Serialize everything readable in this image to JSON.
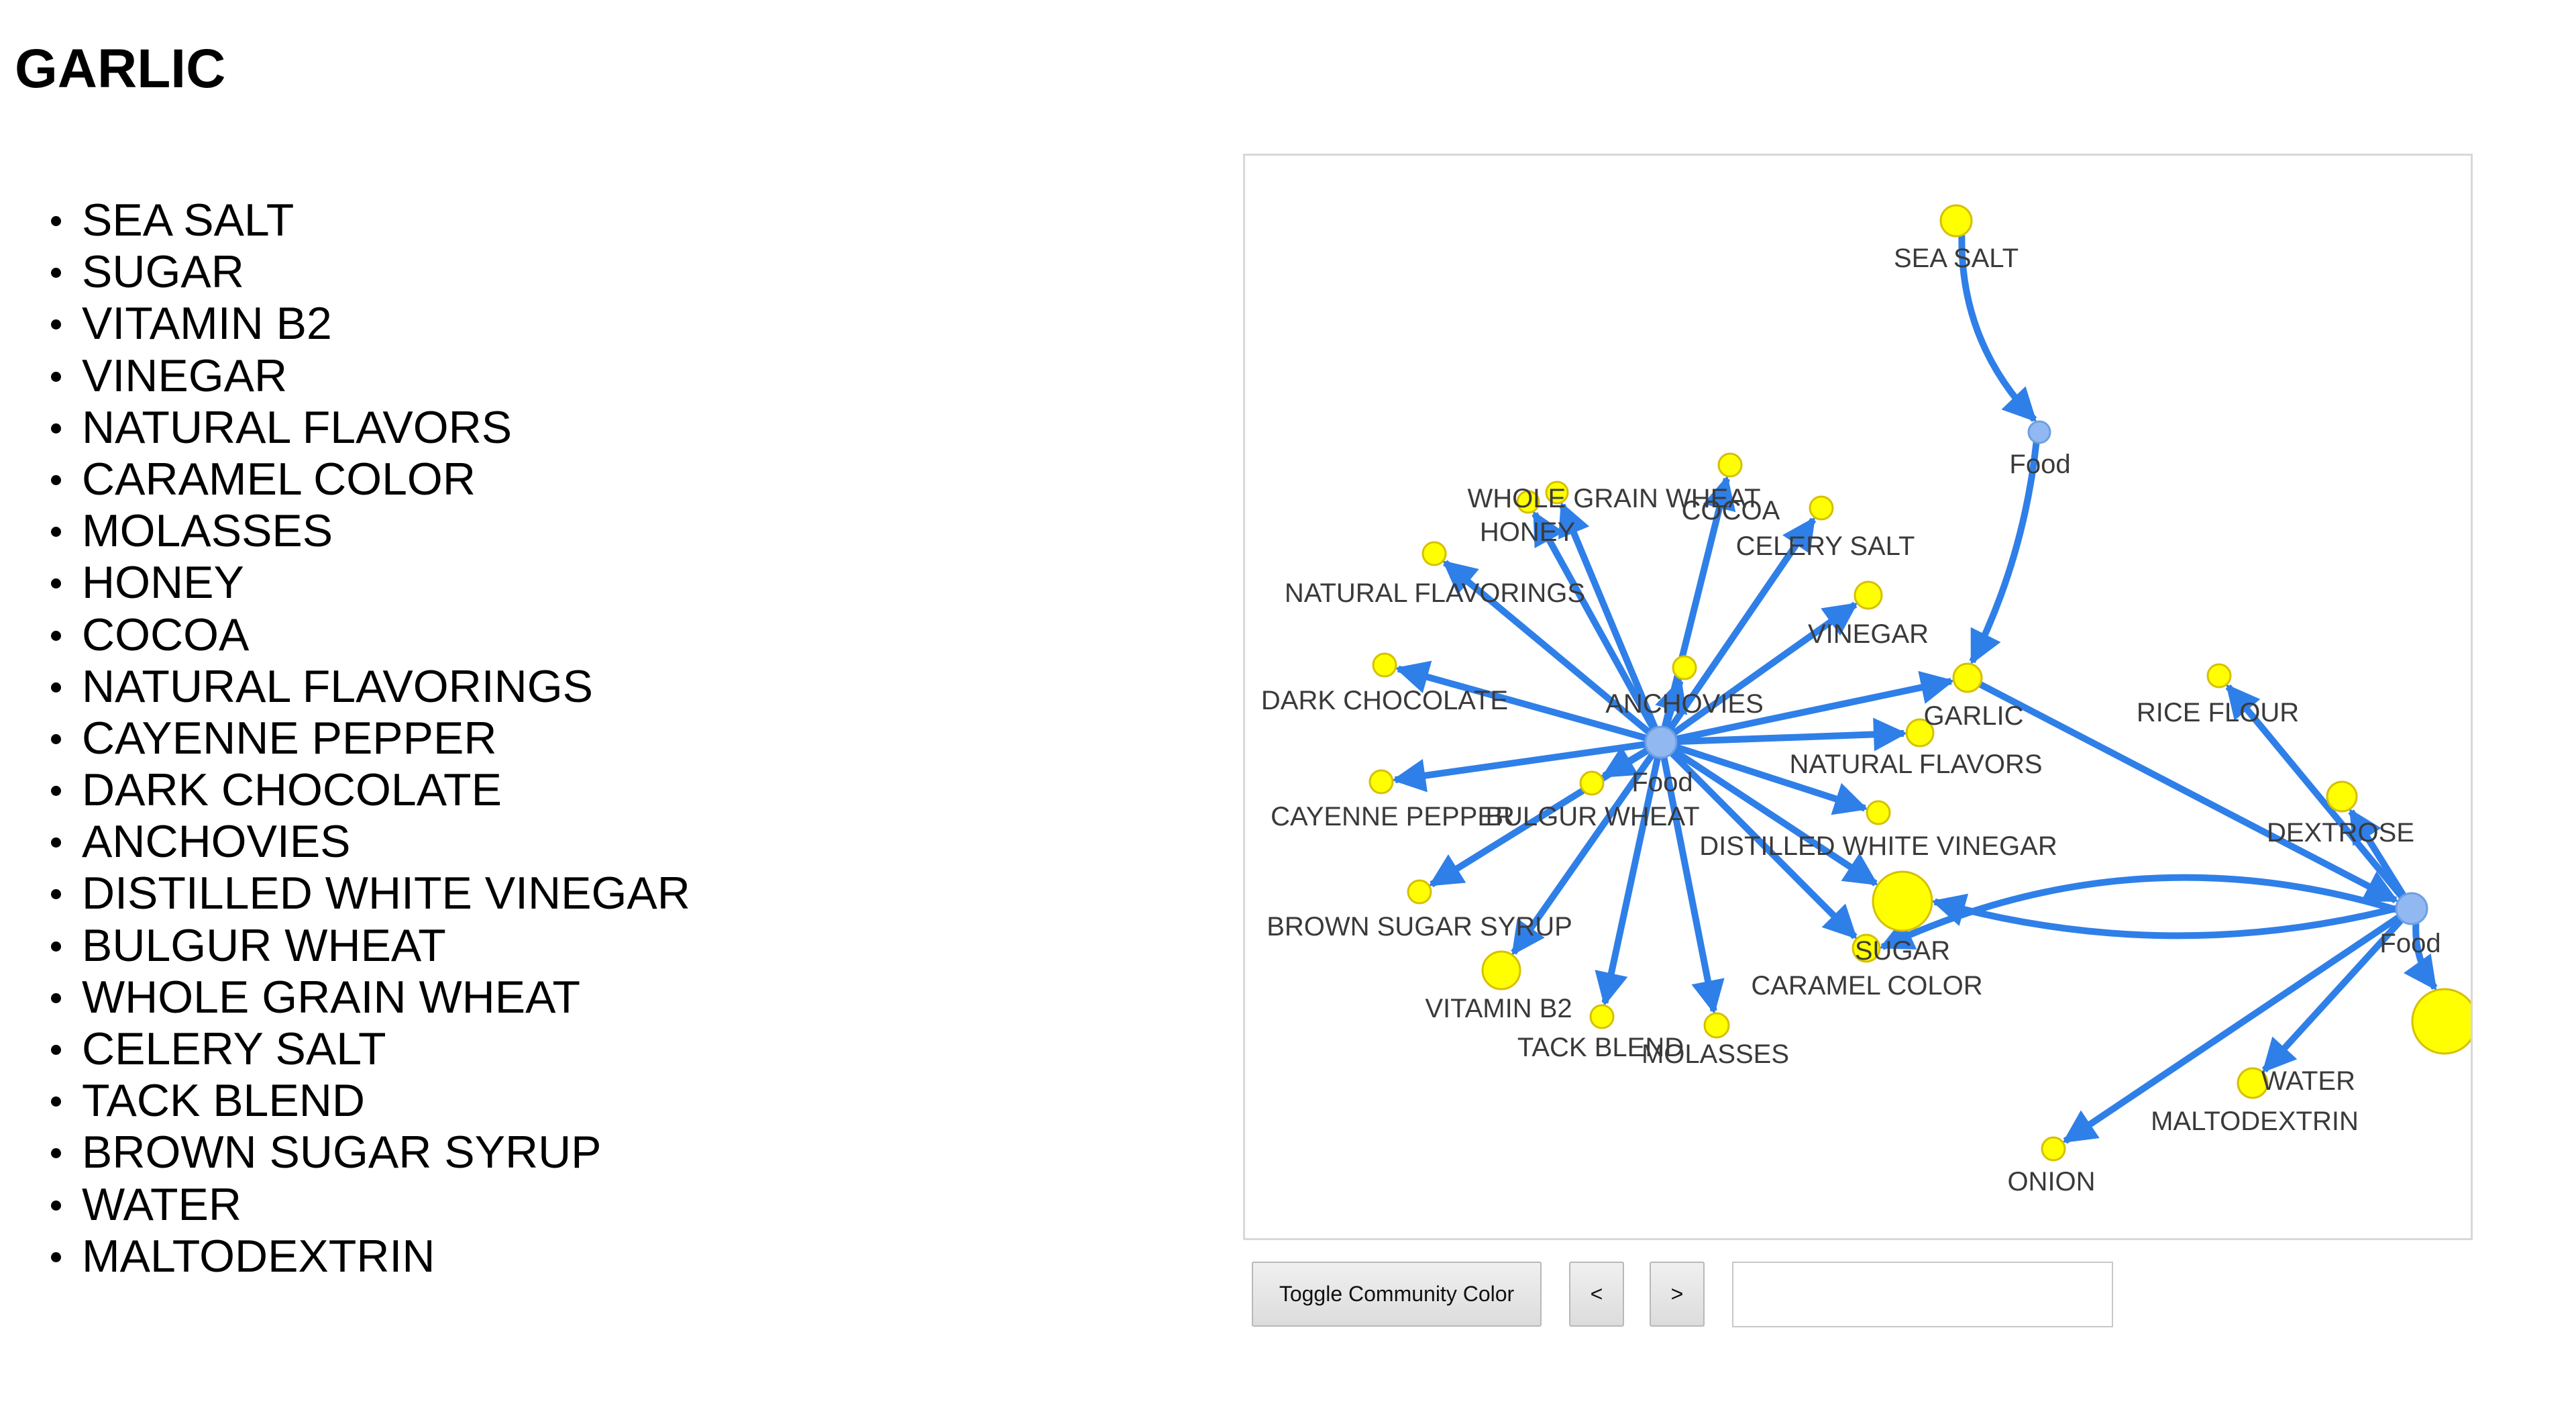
{
  "title": "GARLIC",
  "ingredients": [
    "SEA SALT",
    "SUGAR",
    "VITAMIN B2",
    "VINEGAR",
    "NATURAL FLAVORS",
    "CARAMEL COLOR",
    "MOLASSES",
    "HONEY",
    "COCOA",
    "NATURAL FLAVORINGS",
    "CAYENNE PEPPER",
    "DARK CHOCOLATE",
    "ANCHOVIES",
    "DISTILLED WHITE VINEGAR",
    "BULGUR WHEAT",
    "WHOLE GRAIN WHEAT",
    "CELERY SALT",
    "TACK BLEND",
    "BROWN SUGAR SYRUP",
    "WATER",
    "MALTODEXTRIN"
  ],
  "controls": {
    "toggle_label": "Toggle Community Color",
    "prev_label": "<",
    "next_label": ">",
    "search_value": ""
  },
  "colors": {
    "edge": "#2f7fe8",
    "ingredient_node": "#ffff00",
    "ingredient_stroke": "#d6c000",
    "hub_node": "#92b8f2",
    "hub_stroke": "#6f9fe0"
  },
  "graph": {
    "hubs": [
      {
        "id": "h1",
        "label": "Food"
      },
      {
        "id": "h2",
        "label": "Food"
      },
      {
        "id": "h3",
        "label": "Food"
      }
    ],
    "nodes": [
      {
        "id": "sea_salt",
        "label": "SEA SALT"
      },
      {
        "id": "garlic",
        "label": "GARLIC"
      },
      {
        "id": "whole_grain_wheat",
        "label": "WHOLE GRAIN WHEAT"
      },
      {
        "id": "honey",
        "label": "HONEY"
      },
      {
        "id": "cocoa",
        "label": "COCOA"
      },
      {
        "id": "celery_salt",
        "label": "CELERY SALT"
      },
      {
        "id": "natural_flavorings",
        "label": "NATURAL FLAVORINGS"
      },
      {
        "id": "vinegar",
        "label": "VINEGAR"
      },
      {
        "id": "dark_chocolate",
        "label": "DARK CHOCOLATE"
      },
      {
        "id": "anchovies",
        "label": "ANCHOVIES"
      },
      {
        "id": "natural_flavors",
        "label": "NATURAL FLAVORS"
      },
      {
        "id": "cayenne_pepper",
        "label": "CAYENNE PEPPER"
      },
      {
        "id": "bulgur_wheat",
        "label": "BULGUR WHEAT"
      },
      {
        "id": "distilled_white_vinegar",
        "label": "DISTILLED WHITE VINEGAR"
      },
      {
        "id": "brown_sugar_syrup",
        "label": "BROWN SUGAR SYRUP"
      },
      {
        "id": "sugar",
        "label": "SUGAR"
      },
      {
        "id": "caramel_color",
        "label": "CARAMEL COLOR"
      },
      {
        "id": "vitamin_b2",
        "label": "VITAMIN B2"
      },
      {
        "id": "tack_blend",
        "label": "TACK BLEND"
      },
      {
        "id": "molasses",
        "label": "MOLASSES"
      },
      {
        "id": "rice_flour",
        "label": "RICE FLOUR"
      },
      {
        "id": "dextrose",
        "label": "DEXTROSE"
      },
      {
        "id": "water",
        "label": "WATER"
      },
      {
        "id": "maltodextrin",
        "label": "MALTODEXTRIN"
      },
      {
        "id": "onion",
        "label": "ONION"
      }
    ],
    "edges": [
      [
        "sea_salt",
        "h1"
      ],
      [
        "h1",
        "garlic"
      ],
      [
        "h2",
        "whole_grain_wheat"
      ],
      [
        "h2",
        "honey"
      ],
      [
        "h2",
        "cocoa"
      ],
      [
        "h2",
        "celery_salt"
      ],
      [
        "h2",
        "natural_flavorings"
      ],
      [
        "h2",
        "vinegar"
      ],
      [
        "h2",
        "dark_chocolate"
      ],
      [
        "h2",
        "anchovies"
      ],
      [
        "h2",
        "garlic"
      ],
      [
        "h2",
        "natural_flavors"
      ],
      [
        "h2",
        "cayenne_pepper"
      ],
      [
        "h2",
        "bulgur_wheat"
      ],
      [
        "h2",
        "distilled_white_vinegar"
      ],
      [
        "h2",
        "brown_sugar_syrup"
      ],
      [
        "h2",
        "sugar"
      ],
      [
        "h2",
        "caramel_color"
      ],
      [
        "h2",
        "vitamin_b2"
      ],
      [
        "h2",
        "tack_blend"
      ],
      [
        "h2",
        "molasses"
      ],
      [
        "garlic",
        "h3"
      ],
      [
        "h3",
        "rice_flour"
      ],
      [
        "h3",
        "dextrose"
      ],
      [
        "h3",
        "sugar"
      ],
      [
        "h3",
        "caramel_color"
      ],
      [
        "h3",
        "water"
      ],
      [
        "h3",
        "maltodextrin"
      ],
      [
        "h3",
        "onion"
      ]
    ]
  }
}
